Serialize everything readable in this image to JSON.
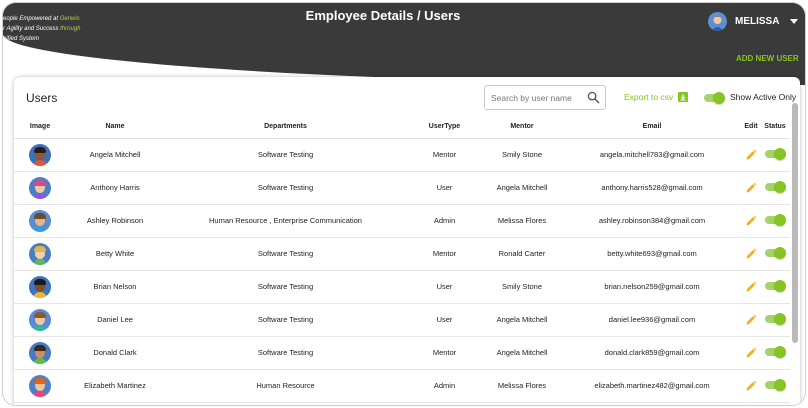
{
  "header": {
    "tagline_line1_prefix": "eople Empowered at ",
    "tagline_line1_brand": "Genwis",
    "tagline_line2_prefix": "r Agility and Success ",
    "tagline_line2_brand": "through",
    "tagline_line3": "nified System",
    "title": "Employee Details / Users",
    "user_name": "MELISSA"
  },
  "actions": {
    "add_user_label": "ADD NEW USER"
  },
  "card": {
    "title": "Users",
    "search_placeholder": "Search by user name",
    "export_label": "Export to csv",
    "active_only_label": "Show Active Only"
  },
  "table": {
    "headers": {
      "image": "Image",
      "name": "Name",
      "departments": "Departments",
      "usertype": "UserType",
      "mentor": "Mentor",
      "email": "Email",
      "edit": "Edit",
      "status": "Status"
    },
    "rows": [
      {
        "name": "Angela Mitchell",
        "departments": "Software Testing",
        "usertype": "Mentor",
        "mentor": "Smily Stone",
        "email": "angela.mitchell783@gmail.com",
        "avatar_bg": "#3f6fb8",
        "hair": "#2b1d12",
        "skin": "#8a5a3a",
        "shirt": "#e2572e"
      },
      {
        "name": "Anthony Harris",
        "departments": "Software Testing",
        "usertype": "User",
        "mentor": "Angela Mitchell",
        "email": "anthony.harris528@gmail.com",
        "avatar_bg": "#4d7fc9",
        "hair": "#d14a8a",
        "skin": "#f1c9a5",
        "shirt": "#8a5bd6"
      },
      {
        "name": "Ashley Robinson",
        "departments": "Human Resource , Enterprise Communication",
        "usertype": "Admin",
        "mentor": "Melissa Flores",
        "email": "ashley.robinson384@gmail.com",
        "avatar_bg": "#5b8bd0",
        "hair": "#6d4a2b",
        "skin": "#e7b48c",
        "shirt": "#3d9ad8"
      },
      {
        "name": "Betty White",
        "departments": "Software Testing",
        "usertype": "Mentor",
        "mentor": "Ronald Carter",
        "email": "betty.white693@gmail.com",
        "avatar_bg": "#4c7bc5",
        "hair": "#e3b34a",
        "skin": "#f3cfae",
        "shirt": "#5cb85c"
      },
      {
        "name": "Brian Nelson",
        "departments": "Software Testing",
        "usertype": "User",
        "mentor": "Smily Stone",
        "email": "brian.nelson259@gmail.com",
        "avatar_bg": "#3f72bd",
        "hair": "#1f1a16",
        "skin": "#7a4e32",
        "shirt": "#f0b43a"
      },
      {
        "name": "Daniel Lee",
        "departments": "Software Testing",
        "usertype": "User",
        "mentor": "Angela Mitchell",
        "email": "daniel.lee936@gmail.com",
        "avatar_bg": "#5a8ad3",
        "hair": "#8b5a2b",
        "skin": "#f2c8a2",
        "shirt": "#2fb4a8"
      },
      {
        "name": "Donald Clark",
        "departments": "Software Testing",
        "usertype": "Mentor",
        "mentor": "Angela Mitchell",
        "email": "donald.clark859@gmail.com",
        "avatar_bg": "#4878c2",
        "hair": "#3a2a1c",
        "skin": "#c98f63",
        "shirt": "#62b946"
      },
      {
        "name": "Elizabeth Martinez",
        "departments": "Human Resource",
        "usertype": "Admin",
        "mentor": "Melissa Flores",
        "email": "elizabeth.martinez482@gmail.com",
        "avatar_bg": "#4f7fcb",
        "hair": "#d9651f",
        "skin": "#f0c39c",
        "shirt": "#e0477c"
      }
    ]
  },
  "colors": {
    "accent": "#86c424",
    "header_bg": "#3a3a3a",
    "edit_icon": "#f2b01e"
  },
  "icons": {
    "search": "search-icon",
    "export": "download-icon",
    "edit": "pencil-icon",
    "menu": "chevron-down-icon"
  }
}
